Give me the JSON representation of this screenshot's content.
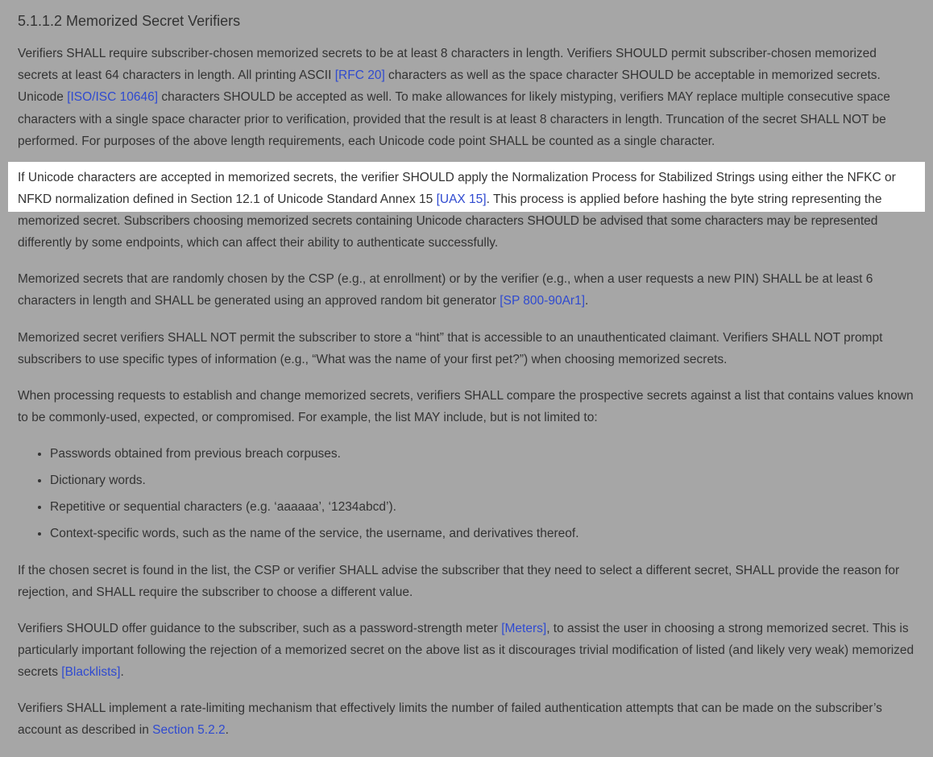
{
  "heading": "5.1.1.2 Memorized Secret Verifiers",
  "p1_a": "Verifiers SHALL require subscriber-chosen memorized secrets to be at least 8 characters in length. Verifiers SHOULD permit subscriber-chosen memorized secrets at least 64 characters in length. All printing ASCII ",
  "ref_rfc20": "[RFC 20]",
  "p1_b": " characters as well as the space character SHOULD be acceptable in memorized secrets. Unicode ",
  "ref_iso": "[ISO/ISC 10646]",
  "p1_c": " characters SHOULD be accepted as well. To make allowances for likely mistyping, verifiers MAY replace multiple consecutive space characters with a single space character prior to verification, provided that the result is at least 8 characters in length. Truncation of the secret SHALL NOT be performed. For purposes of the above length requirements, each Unicode code point SHALL be counted as a single character.",
  "p2_a": "If Unicode characters are accepted in memorized secrets, the verifier SHOULD apply the Normalization Process for Stabilized Strings using either the NFKC or NFKD normalization defined in Section 12.1 of Unicode Standard Annex 15 ",
  "ref_uax15": "[UAX 15]",
  "p2_b": ". This process is applied before hashing the byte string representing the memorized secret. Subscribers choosing memorized secrets containing Unicode characters SHOULD be advised that some characters may be represented differently by some endpoints, which can affect their ability to authenticate successfully.",
  "p3_a": "Memorized secrets that are randomly chosen by the CSP (e.g., at enrollment) or by the verifier (e.g., when a user requests a new PIN) SHALL be at least 6 characters in length and SHALL be generated using an approved random bit generator ",
  "ref_sp800": "[SP 800-90Ar1]",
  "p3_b": ".",
  "p4": "Memorized secret verifiers SHALL NOT permit the subscriber to store a “hint” that is accessible to an unauthenticated claimant. Verifiers SHALL NOT prompt subscribers to use specific types of information (e.g., “What was the name of your first pet?”) when choosing memorized secrets.",
  "p5": "When processing requests to establish and change memorized secrets, verifiers SHALL compare the prospective secrets against a list that contains values known to be commonly-used, expected, or compromised. For example, the list MAY include, but is not limited to:",
  "list": {
    "i0": "Passwords obtained from previous breach corpuses.",
    "i1": "Dictionary words.",
    "i2": "Repetitive or sequential characters (e.g. ‘aaaaaa’, ‘1234abcd’).",
    "i3": "Context-specific words, such as the name of the service, the username, and derivatives thereof."
  },
  "p6": "If the chosen secret is found in the list, the CSP or verifier SHALL advise the subscriber that they need to select a different secret, SHALL provide the reason for rejection, and SHALL require the subscriber to choose a different value.",
  "p7_a": "Verifiers SHOULD offer guidance to the subscriber, such as a password-strength meter ",
  "ref_meters": "[Meters]",
  "p7_b": ", to assist the user in choosing a strong memorized secret. This is particularly important following the rejection of a memorized secret on the above list as it discourages trivial modification of listed (and likely very weak) memorized secrets ",
  "ref_blacklists": "[Blacklists]",
  "p7_c": ".",
  "p8_a": "Verifiers SHALL implement a rate-limiting mechanism that effectively limits the number of failed authentication attempts that can be made on the subscriber’s account as described in ",
  "ref_sec522": "Section 5.2.2",
  "p8_b": "."
}
